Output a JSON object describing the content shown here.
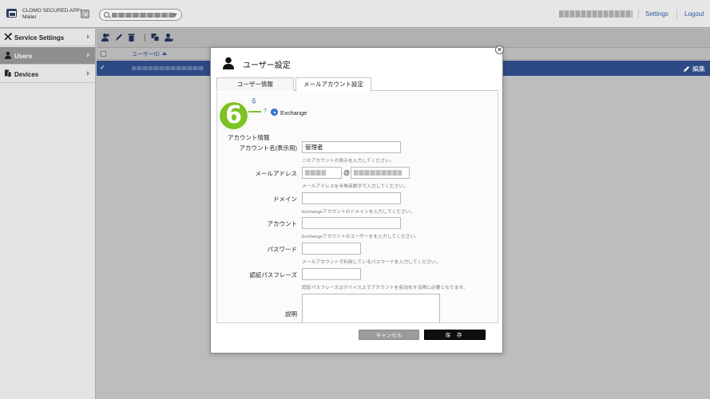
{
  "header": {
    "app_name_line1": "CLOMO SECURED APPs",
    "app_name_line2": "Mailer",
    "settings_label": "Settings",
    "logout_label": "Logout"
  },
  "sidebar": {
    "items": [
      {
        "label": "Service Settings",
        "icon": "tools-icon",
        "active": false
      },
      {
        "label": "Users",
        "icon": "user-icon",
        "active": true
      },
      {
        "label": "Devices",
        "icon": "devices-icon",
        "active": false
      }
    ]
  },
  "list": {
    "column_user_id": "ユーザーID",
    "row_check": "✓",
    "edit_label": "編集"
  },
  "modal": {
    "title": "ユーザー設定",
    "close_glyph": "×",
    "tabs": [
      {
        "label": "ユーザー情報",
        "active": false
      },
      {
        "label": "メールアカウント設定",
        "active": true
      }
    ],
    "connection_link": "る",
    "step_number": "6",
    "radio_prev_fragment": "?",
    "radio_exchange_label": "Exchange",
    "section_title": "アカウント情報",
    "fields": {
      "account_name": {
        "label": "アカウント名(表示用)",
        "value": "管理者",
        "hint": "このアカウントの表示を入力してください。"
      },
      "email": {
        "label": "メールアドレス",
        "at": "@",
        "hint": "メールアドレスを半角英数字で入力してください。"
      },
      "domain": {
        "label": "ドメイン",
        "hint": "Exchangeアカウントのドメインを入力してください。"
      },
      "account": {
        "label": "アカウント",
        "hint": "Exchangeアカウントのユーザーをを入力してください。"
      },
      "password": {
        "label": "パスワード",
        "hint": "メールアカウントで利用しているパスワードを入力してください。"
      },
      "passphrase": {
        "label": "認証パスフレーズ",
        "hint": "認証パスフレーズはデバイス上でアカウントを有効化する際に必要となります。"
      },
      "description": {
        "label": "説明"
      }
    },
    "cancel_label": "キャンセル",
    "save_label": "保 存"
  },
  "colors": {
    "selected_row": "#2c4a84",
    "step_badge": "#7cc223",
    "link": "#2d5aa1",
    "save_button": "#0e0e0e"
  }
}
